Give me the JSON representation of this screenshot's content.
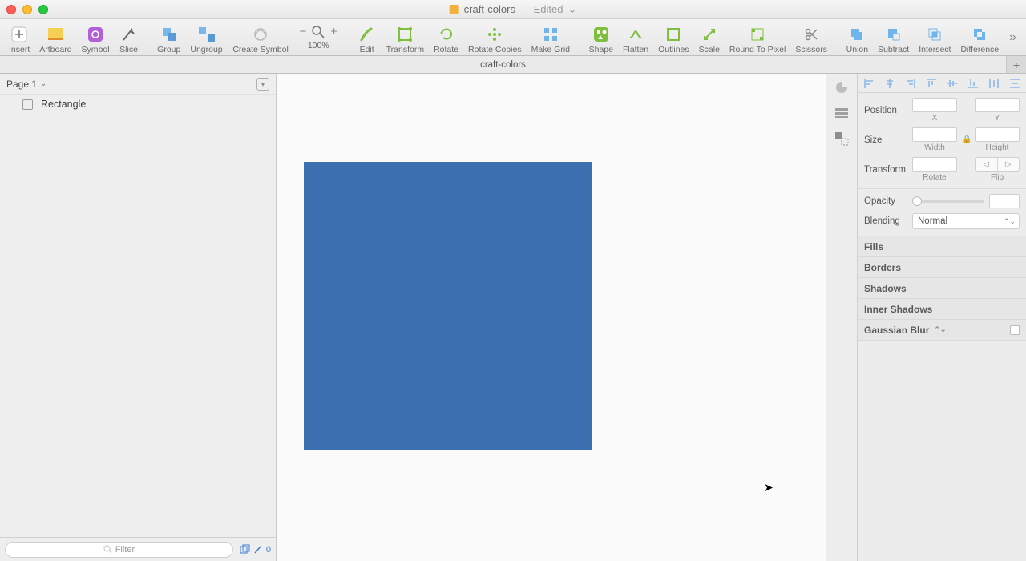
{
  "window": {
    "title": "craft-colors",
    "edited": "— Edited",
    "dropdown_glyph": "⌄"
  },
  "toolbar": {
    "insert": "Insert",
    "artboard": "Artboard",
    "symbol": "Symbol",
    "slice": "Slice",
    "group": "Group",
    "ungroup": "Ungroup",
    "create_symbol": "Create Symbol",
    "zoom": "100%",
    "edit": "Edit",
    "transform": "Transform",
    "rotate": "Rotate",
    "rotate_copies": "Rotate Copies",
    "make_grid": "Make Grid",
    "shape": "Shape",
    "flatten": "Flatten",
    "outlines": "Outlines",
    "scale": "Scale",
    "round_to_pixel": "Round To Pixel",
    "scissors": "Scissors",
    "union": "Union",
    "subtract": "Subtract",
    "intersect": "Intersect",
    "difference": "Difference"
  },
  "tabs": {
    "name": "craft-colors"
  },
  "pages": {
    "current": "Page 1"
  },
  "layers": {
    "items": [
      {
        "name": "Rectangle"
      }
    ]
  },
  "left_footer": {
    "filter_placeholder": "Filter",
    "count": "0"
  },
  "canvas": {
    "shape_color": "#3b6fb0"
  },
  "inspector": {
    "position": "Position",
    "x": "X",
    "y": "Y",
    "size": "Size",
    "width": "Width",
    "height": "Height",
    "transform": "Transform",
    "rotate": "Rotate",
    "flip": "Flip",
    "opacity": "Opacity",
    "blending": "Blending",
    "blend_mode": "Normal",
    "fills": "Fills",
    "borders": "Borders",
    "shadows": "Shadows",
    "inner_shadows": "Inner Shadows",
    "gaussian_blur": "Gaussian Blur"
  }
}
